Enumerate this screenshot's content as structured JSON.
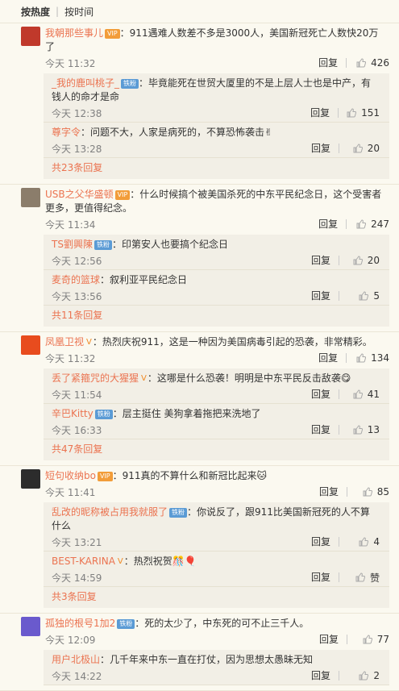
{
  "sort": {
    "hot": "按热度",
    "time": "按时间"
  },
  "reply_label": "回复",
  "comments": [
    {
      "name": "我朝那些事儿",
      "badge": "VIP",
      "text": "：911遇难人数差不多是3000人，美国新冠死亡人数快20万了",
      "time": "今天 11:32",
      "likes": "426",
      "avatar_color": "#c0392b",
      "subs": [
        {
          "name": "_我的鹿叫桃子_",
          "badge": "铁粉",
          "text": "：毕竟能死在世贸大厦里的不是上层人士也是中产，有钱人的命才是命",
          "time": "今天 12:38",
          "likes": "151"
        },
        {
          "name": "尊字令",
          "badge": "",
          "text": "：问题不大，人家是病死的，不算恐怖袭击✌",
          "time": "今天 13:28",
          "likes": "20"
        }
      ],
      "more": "共23条回复"
    },
    {
      "name": "USB之父华盛顿",
      "badge": "VIP",
      "text": "：什么时候搞个被美国杀死的中东平民纪念日，这个受害者更多，更值得纪念。",
      "time": "今天 11:34",
      "likes": "247",
      "avatar_color": "#8b7d6b",
      "subs": [
        {
          "name": "TS劉興陳",
          "badge": "铁粉",
          "text": "：印第安人也要搞个纪念日",
          "time": "今天 12:56",
          "likes": "20"
        },
        {
          "name": "麦奇的篮球",
          "badge": "",
          "text": "：叙利亚平民纪念日",
          "time": "今天 13:56",
          "likes": "5"
        }
      ],
      "more": "共11条回复"
    },
    {
      "name": "凤凰卫视",
      "badge": "V",
      "text": "：热烈庆祝911，这是一种因为美国病毒引起的恐袭，非常精彩。",
      "time": "今天 11:32",
      "likes": "134",
      "avatar_color": "#e84c1e",
      "subs": [
        {
          "name": "丢了紧箍咒的大猩猩",
          "badge": "V",
          "text": "：这哪是什么恐袭！明明是中东平民反击敌袭😋",
          "time": "今天 11:54",
          "likes": "41"
        },
        {
          "name": "辛巴Kitty",
          "badge": "铁粉",
          "text": "：层主挺住 美狗拿着拖把来洗地了",
          "time": "今天 16:33",
          "likes": "13"
        }
      ],
      "more": "共47条回复"
    },
    {
      "name": "短句收纳bo",
      "badge": "VIP",
      "text": "：911真的不算什么和新冠比起来🐱",
      "time": "今天 11:41",
      "likes": "85",
      "avatar_color": "#2c2c2c",
      "subs": [
        {
          "name": "乱改的昵称被占用我就服了",
          "badge": "铁粉",
          "text": "：你说反了，跟911比美国新冠死的人不算什么",
          "time": "今天 13:21",
          "likes": "4"
        },
        {
          "name": "BEST-KARINA",
          "badge": "V",
          "text": "：热烈祝贺🎊🎈",
          "time": "今天 14:59",
          "likes": "赞"
        }
      ],
      "more": "共3条回复"
    },
    {
      "name": "孤独的根号1加2",
      "badge": "铁粉",
      "text": "：死的太少了，中东死的可不止三千人。",
      "time": "今天 12:09",
      "likes": "77",
      "avatar_color": "#6a5acd",
      "subs": [
        {
          "name": "用户北极山",
          "badge": "",
          "text": "：几千年来中东一直在打仗，因为思想太愚昧无知",
          "time": "今天 14:22",
          "likes": "2"
        }
      ],
      "more": ""
    }
  ]
}
